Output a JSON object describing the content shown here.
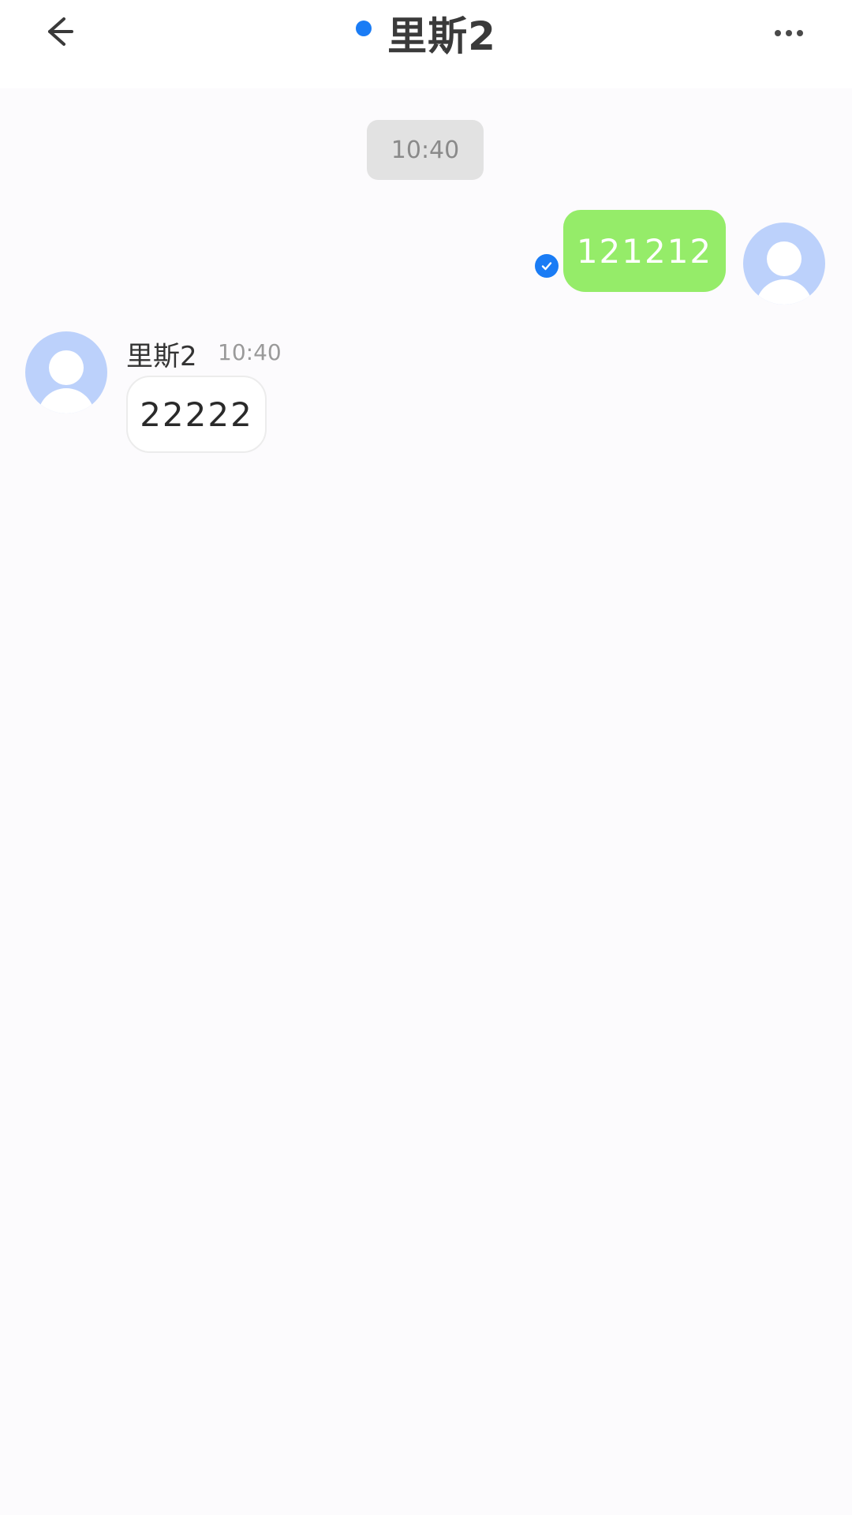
{
  "header": {
    "title": "里斯2",
    "status_color": "#1a7cf5",
    "back_icon": "back-arrow-icon",
    "more_icon": "more-horizontal-icon"
  },
  "chat": {
    "divider_time": "10:40",
    "messages": [
      {
        "direction": "sent",
        "text": "121212",
        "read": true,
        "bubble_color": "#95ec69"
      },
      {
        "direction": "received",
        "sender": "里斯2",
        "time": "10:40",
        "text": "22222",
        "bubble_color": "#ffffff"
      }
    ]
  }
}
